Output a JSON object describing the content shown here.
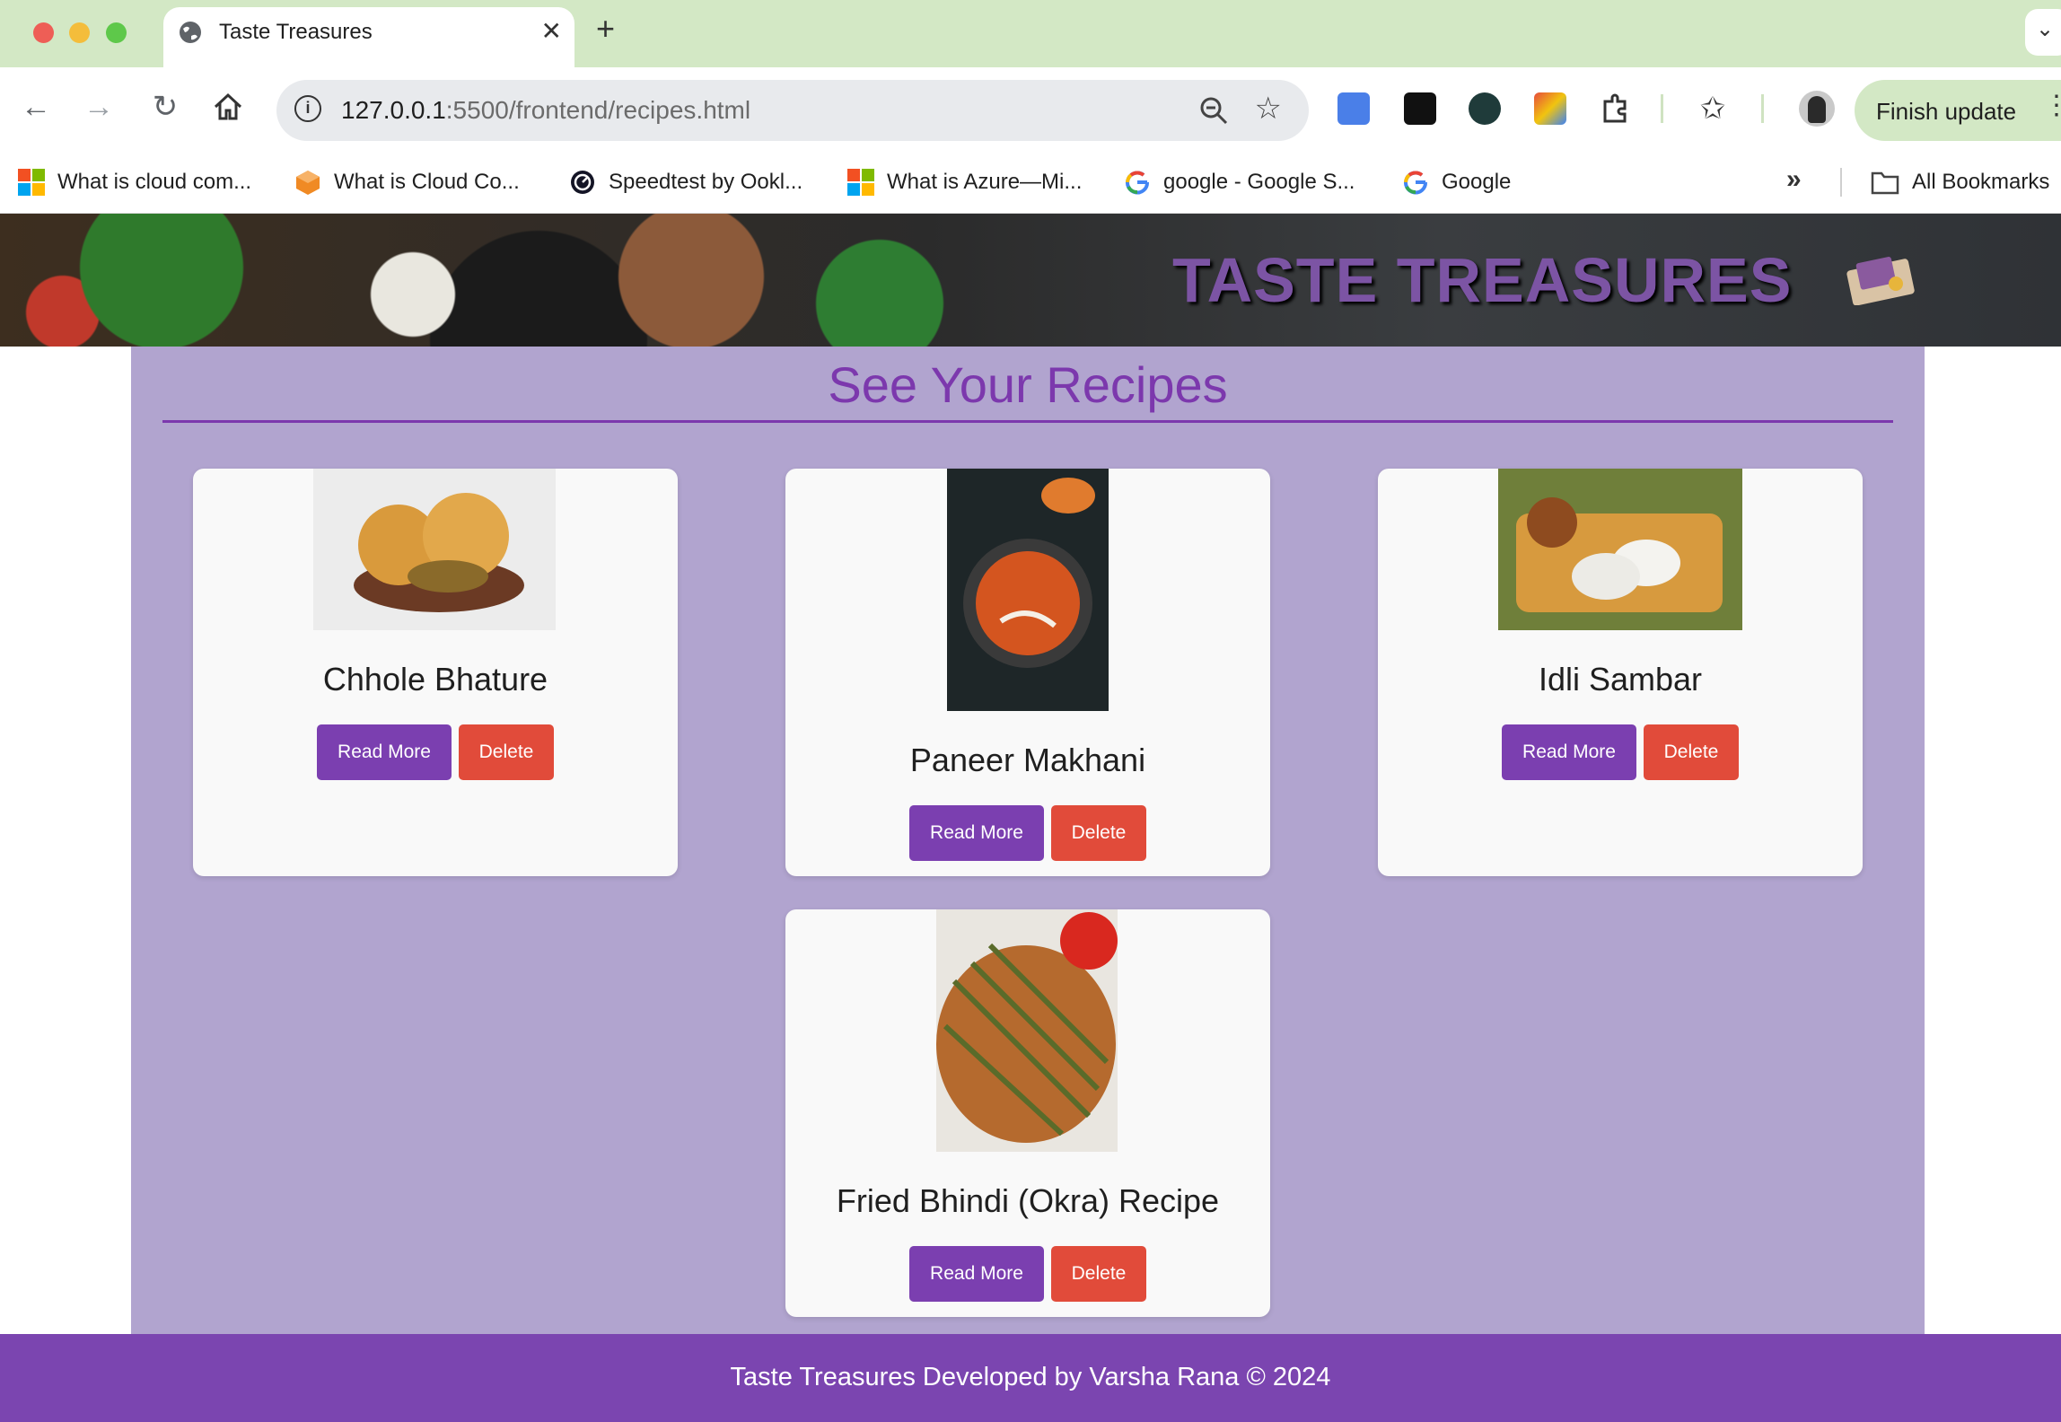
{
  "browser": {
    "tab_title": "Taste Treasures",
    "url_host": "127.0.0.1",
    "url_path": ":5500/frontend/recipes.html",
    "finish_update": "Finish update",
    "bookmarks": [
      {
        "label": "What is cloud com...",
        "icon": "microsoft-icon"
      },
      {
        "label": "What is Cloud Co...",
        "icon": "cube-icon"
      },
      {
        "label": "Speedtest by Ookl...",
        "icon": "speedtest-icon"
      },
      {
        "label": "What is Azure—Mi...",
        "icon": "microsoft-icon"
      },
      {
        "label": "google - Google S...",
        "icon": "google-icon"
      },
      {
        "label": "Google",
        "icon": "google-icon"
      }
    ],
    "all_bookmarks": "All Bookmarks"
  },
  "banner": {
    "title": "TASTE TREASURES"
  },
  "main": {
    "heading": "See Your Recipes",
    "recipes": [
      {
        "name": "Chhole Bhature",
        "read_more": "Read More",
        "delete": "Delete"
      },
      {
        "name": "Paneer Makhani",
        "read_more": "Read More",
        "delete": "Delete"
      },
      {
        "name": "Idli Sambar",
        "read_more": "Read More",
        "delete": "Delete"
      },
      {
        "name": "Fried Bhindi (Okra) Recipe",
        "read_more": "Read More",
        "delete": "Delete"
      }
    ]
  },
  "footer": {
    "text": "Taste Treasures Developed by Varsha Rana © 2024"
  },
  "colors": {
    "tabbar": "#d3e8c5",
    "main_bg": "#b1a4cf",
    "accent_purple": "#7b3fb0",
    "delete_red": "#e14b3a",
    "footer": "#7b45b0"
  }
}
